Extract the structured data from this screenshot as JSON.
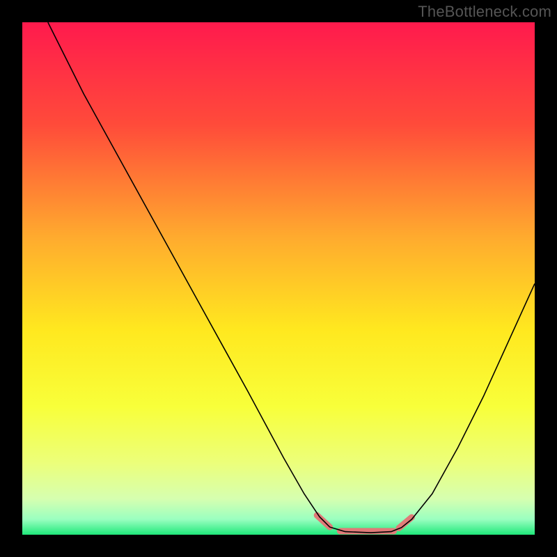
{
  "attribution": "TheBottleneck.com",
  "chart_data": {
    "type": "line",
    "title": "",
    "xlabel": "",
    "ylabel": "",
    "xlim": [
      0,
      100
    ],
    "ylim": [
      0,
      100
    ],
    "background_gradient": {
      "stops": [
        {
          "offset": 0,
          "color": "#ff1a4d"
        },
        {
          "offset": 20,
          "color": "#ff4b3a"
        },
        {
          "offset": 42,
          "color": "#ffab2e"
        },
        {
          "offset": 60,
          "color": "#ffe81f"
        },
        {
          "offset": 75,
          "color": "#f8ff3a"
        },
        {
          "offset": 86,
          "color": "#ecff7a"
        },
        {
          "offset": 93,
          "color": "#d6ffb0"
        },
        {
          "offset": 97,
          "color": "#9affc0"
        },
        {
          "offset": 100,
          "color": "#1fe87a"
        }
      ]
    },
    "series": [
      {
        "name": "bottleneck-curve",
        "color": "#000000",
        "width": 1.6,
        "points": [
          {
            "x": 5,
            "y": 100
          },
          {
            "x": 12,
            "y": 86
          },
          {
            "x": 20,
            "y": 71.5
          },
          {
            "x": 28,
            "y": 57
          },
          {
            "x": 36,
            "y": 42.5
          },
          {
            "x": 44,
            "y": 28
          },
          {
            "x": 51,
            "y": 15
          },
          {
            "x": 55,
            "y": 8
          },
          {
            "x": 58,
            "y": 3.5
          },
          {
            "x": 60,
            "y": 1.5
          },
          {
            "x": 63,
            "y": 0.6
          },
          {
            "x": 68,
            "y": 0.4
          },
          {
            "x": 72,
            "y": 0.6
          },
          {
            "x": 74,
            "y": 1.4
          },
          {
            "x": 76,
            "y": 3
          },
          {
            "x": 80,
            "y": 8
          },
          {
            "x": 85,
            "y": 17
          },
          {
            "x": 90,
            "y": 27
          },
          {
            "x": 95,
            "y": 38
          },
          {
            "x": 100,
            "y": 49
          }
        ]
      }
    ],
    "markers": [
      {
        "name": "valley-markers",
        "color": "#e07a78",
        "width": 9,
        "segments": [
          [
            {
              "x": 57.5,
              "y": 3.8
            },
            {
              "x": 60,
              "y": 1.5
            }
          ],
          [
            {
              "x": 62,
              "y": 0.7
            },
            {
              "x": 72.5,
              "y": 0.7
            }
          ],
          [
            {
              "x": 73.5,
              "y": 1.3
            },
            {
              "x": 76,
              "y": 3.4
            }
          ]
        ]
      }
    ]
  }
}
